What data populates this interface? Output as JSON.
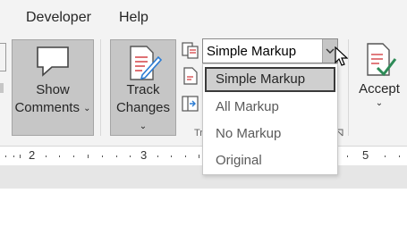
{
  "tabs": {
    "developer": "Developer",
    "help": "Help"
  },
  "show_comments": {
    "line1": "Show",
    "line2": "Comments",
    "chevron": "⌄"
  },
  "track_changes": {
    "line1": "Track",
    "line2": "Changes",
    "chevron": "⌄"
  },
  "markup_combo": {
    "value": "Simple Markup"
  },
  "markup_options": [
    "Simple Markup",
    "All Markup",
    "No Markup",
    "Original"
  ],
  "selected_option_index": 0,
  "accept": {
    "label": "Accept",
    "chevron": "⌄"
  },
  "group_label_fragment": "Tr",
  "ruler": {
    "numbers": [
      "2",
      "3",
      "5"
    ]
  },
  "colors": {
    "accent_red": "#d13438",
    "accent_green": "#2e8b57",
    "accent_blue": "#2b7cd3"
  },
  "icons": [
    "comment-icon",
    "track-changes-icon",
    "accept-icon",
    "pointer-cursor-icon"
  ]
}
